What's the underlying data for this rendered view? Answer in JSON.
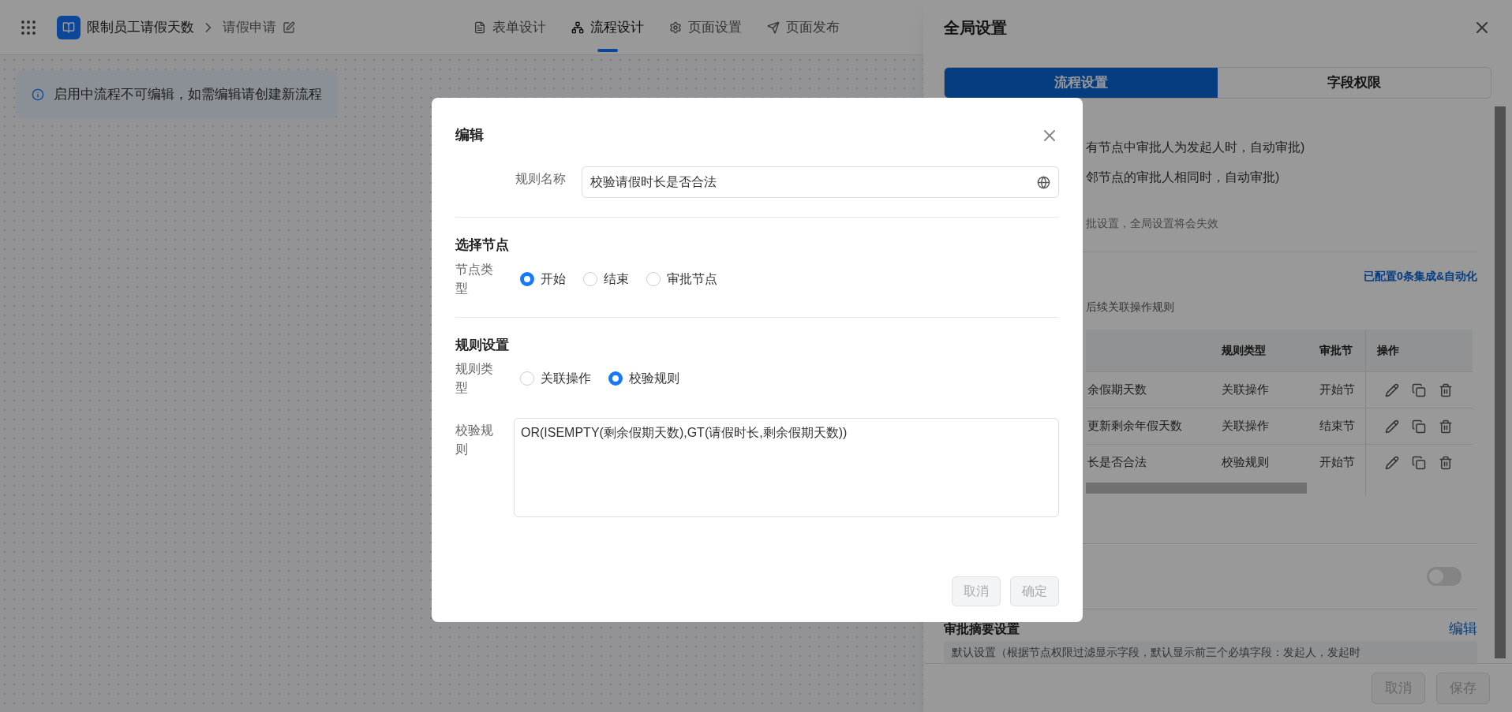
{
  "app_bar": {
    "app_name": "限制员工请假天数",
    "page_name": "请假申请",
    "tabs": [
      {
        "label": "表单设计",
        "kind": "form",
        "selected": false
      },
      {
        "label": "流程设计",
        "kind": "flow",
        "selected": true
      },
      {
        "label": "页面设置",
        "kind": "settings",
        "selected": false
      },
      {
        "label": "页面发布",
        "kind": "publish",
        "selected": false
      }
    ]
  },
  "notice": "启用中流程不可编辑，如需编辑请创建新流程",
  "drawer": {
    "title": "全局设置",
    "tabs": [
      {
        "label": "流程设置",
        "selected": true
      },
      {
        "label": "字段权限",
        "selected": false
      }
    ],
    "options": [
      "有节点中审批人为发起人时，自动审批)",
      "邻节点的审批人相同时，自动审批)"
    ],
    "note": "批设置，全局设置将会失效",
    "integration_link": "已配置0条集成&自动化",
    "rules_hint": "后续关联操作规则",
    "table": {
      "columns": [
        "规则类型",
        "审批节",
        "操作"
      ],
      "rows": [
        {
          "name": "余假期天数",
          "type": "关联操作",
          "node": "开始节"
        },
        {
          "name": "更新剩余年假天数",
          "type": "关联操作",
          "node": "结束节"
        },
        {
          "name": "长是否合法",
          "type": "校验规则",
          "node": "开始节"
        }
      ]
    },
    "toggle": {
      "on": false
    },
    "summary": {
      "title": "审批摘要设置",
      "edit": "编辑",
      "text": "默认设置（根据节点权限过滤显示字段，默认显示前三个必填字段：发起人，发起时"
    },
    "buttons": [
      "取消",
      "保存"
    ]
  },
  "dialog": {
    "title": "编辑",
    "name_label": "规则名称",
    "name_value": "校验请假时长是否合法",
    "node_section": "选择节点",
    "node_label": "节点类型",
    "node_options": [
      {
        "label": "开始",
        "selected": true
      },
      {
        "label": "结束",
        "selected": false
      },
      {
        "label": "审批节点",
        "selected": false
      }
    ],
    "rule_section": "规则设置",
    "rule_label": "规则类型",
    "rule_options": [
      {
        "label": "关联操作",
        "selected": false
      },
      {
        "label": "校验规则",
        "selected": true
      }
    ],
    "formula_label": "校验规则",
    "formula": "OR(ISEMPTY(剩余假期天数),GT(请假时长,剩余假期天数))",
    "buttons": [
      "取消",
      "确定"
    ]
  }
}
